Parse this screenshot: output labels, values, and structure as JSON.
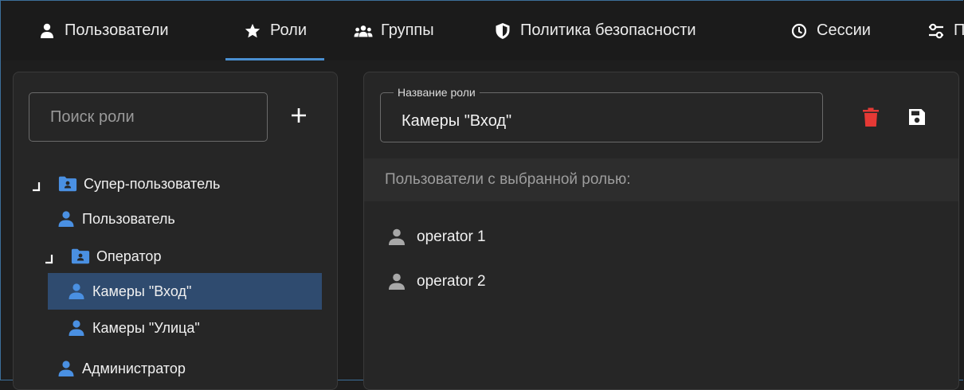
{
  "colors": {
    "accent": "#4a8fd1",
    "selected_bg": "#2f4b6f",
    "delete": "#e53935",
    "user_icon": "#4a90e2",
    "muted_user_icon": "#a8a8a8"
  },
  "nav": {
    "tabs": [
      {
        "label": "Пользователи",
        "icon": "person-icon"
      },
      {
        "label": "Роли",
        "icon": "star-icon",
        "active": true
      },
      {
        "label": "Группы",
        "icon": "group-icon"
      },
      {
        "label": "Политика безопасности",
        "icon": "shield-icon"
      },
      {
        "label": "Сессии",
        "icon": "clock-icon"
      },
      {
        "label": "П",
        "icon": "settings-sliders-icon"
      }
    ]
  },
  "roles": {
    "search_placeholder": "Поиск роли",
    "tree": [
      {
        "label": "Супер-пользователь",
        "icon": "folder-user-icon",
        "expanded": true
      },
      {
        "label": "Пользователь",
        "icon": "person-icon"
      },
      {
        "label": "Оператор",
        "icon": "folder-user-icon",
        "expanded": true
      },
      {
        "label": "Камеры \"Вход\"",
        "icon": "person-icon",
        "selected": true
      },
      {
        "label": "Камеры \"Улица\"",
        "icon": "person-icon"
      },
      {
        "label": "Администратор",
        "icon": "person-icon"
      }
    ]
  },
  "detail": {
    "role_name_label": "Название роли",
    "role_name_value": "Камеры \"Вход\"",
    "users_header": "Пользователи с выбранной ролью:",
    "users": [
      {
        "name": "operator 1"
      },
      {
        "name": "operator 2"
      }
    ]
  }
}
